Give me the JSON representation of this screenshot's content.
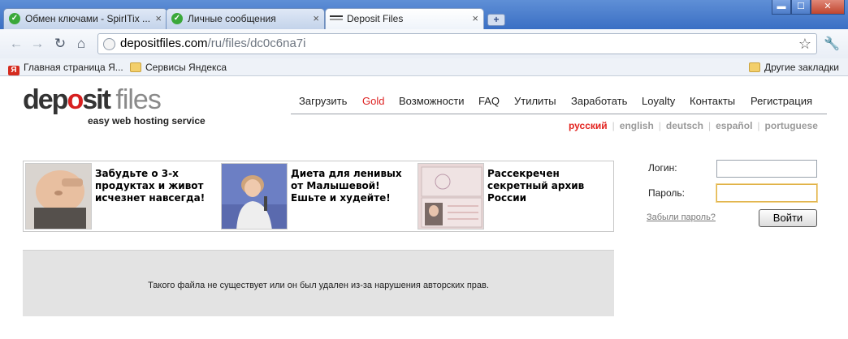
{
  "browser": {
    "tabs": [
      {
        "title": "Обмен ключами - SpirITix ..."
      },
      {
        "title": "Личные сообщения"
      },
      {
        "title": "Deposit Files"
      }
    ],
    "new_tab_label": "+",
    "window_controls": {
      "minimize": "▬",
      "maximize": "☐",
      "close": "✕"
    },
    "url_host": "depositfiles.com",
    "url_path": "/ru/files/dc0c6na7i",
    "bookmarks": [
      {
        "label": "Главная страница Я...",
        "icon": "yandex-icon"
      },
      {
        "label": "Сервисы Яндекса",
        "icon": "folder-icon"
      }
    ],
    "other_bookmarks": "Другие закладки"
  },
  "site": {
    "logo": {
      "dep": "dep",
      "o": "o",
      "sit": "sit",
      "files": "files",
      "tagline": "easy web hosting service"
    },
    "nav": [
      "Загрузить",
      "Gold",
      "Возможности",
      "FAQ",
      "Утилиты",
      "Заработать",
      "Loyalty",
      "Контакты",
      "Регистрация"
    ],
    "languages": {
      "current": "русский",
      "others": [
        "english",
        "deutsch",
        "español",
        "portuguese"
      ]
    },
    "ads": [
      {
        "text": "Забудьте о 3-х продуктах и живот исчезнет навсегда!"
      },
      {
        "text": "Диета для ленивых от Малышевой! Ешьте и худейте!"
      },
      {
        "text": "Рассекречен секретный архив России"
      }
    ],
    "login": {
      "login_label": "Логин:",
      "password_label": "Пароль:",
      "forgot": "Забыли пароль?",
      "submit": "Войти",
      "login_value": "",
      "password_value": ""
    },
    "notice": "Такого файла не существует или он был удален из-за нарушения авторских прав."
  },
  "colors": {
    "accent_red": "#e3231f",
    "chrome_blue": "#3a6fc4"
  }
}
